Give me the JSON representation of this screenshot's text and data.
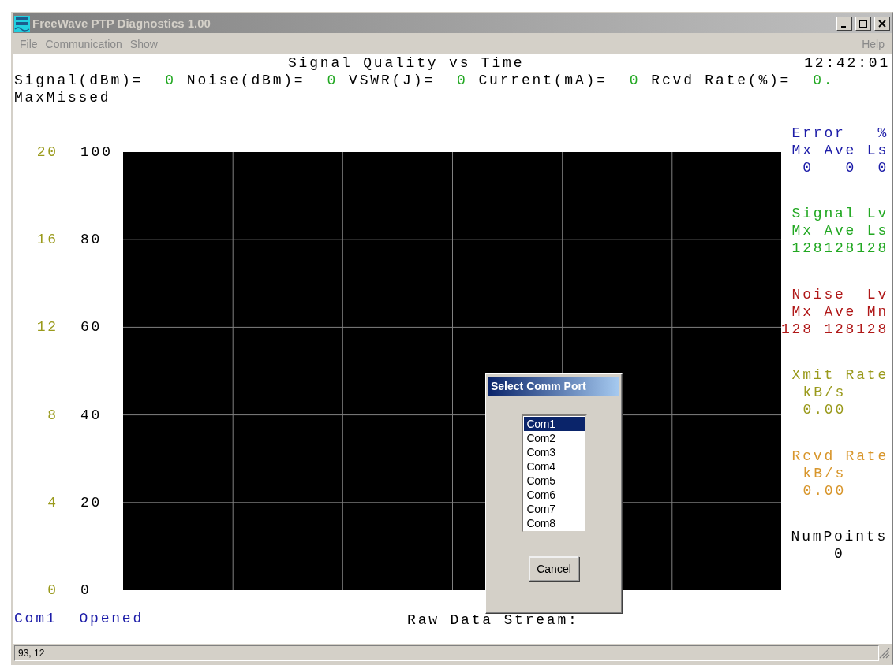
{
  "window": {
    "title": "FreeWave PTP Diagnostics 1.00",
    "active": false
  },
  "menu": [
    {
      "label": "File",
      "disabled": true
    },
    {
      "label": "Communication",
      "disabled": true
    },
    {
      "label": "Show",
      "disabled": true
    }
  ],
  "help_menu": {
    "label": "Help",
    "disabled": true
  },
  "header": {
    "title": "Signal Quality vs Time",
    "time": "12:42:01"
  },
  "readings": [
    {
      "label": "Signal(dBm)=",
      "value": "0"
    },
    {
      "label": "Noise(dBm)=",
      "value": "0"
    },
    {
      "label": "VSWR(J)=",
      "value": "0"
    },
    {
      "label": "Current(mA)=",
      "value": "0"
    },
    {
      "label": "Rcvd Rate(%)=",
      "value": "0."
    }
  ],
  "max_missed": "MaxMissed",
  "chart": {
    "left_axis": [
      "20",
      "16",
      "12",
      "8",
      "4",
      "0"
    ],
    "right_axis": [
      "100",
      "80",
      "60",
      "40",
      "20",
      "0"
    ]
  },
  "stats": [
    {
      "kind": "table",
      "color": "#1c1ca8",
      "lines": [
        "Error   %",
        "Mx Ave Ls",
        "0   0  0"
      ]
    },
    {
      "kind": "table",
      "color": "#22a822",
      "lines": [
        "Signal Lv",
        "Mx Ave Ls",
        "128128128"
      ]
    },
    {
      "kind": "table",
      "color": "#b01818",
      "lines": [
        "Noise  Lv",
        "Mx Ave Mn",
        "128 128128"
      ]
    },
    {
      "kind": "rate",
      "color": "#9a9a1c",
      "lines": [
        "Xmit Rate",
        "kB/s",
        "0.00"
      ]
    },
    {
      "kind": "rate",
      "color": "#d8962c",
      "lines": [
        "Rcvd Rate",
        "kB/s",
        "0.00"
      ]
    },
    {
      "kind": "count",
      "color": "#000000",
      "lines": [
        "NumPoints",
        "0"
      ]
    }
  ],
  "raw_data_label": "Raw Data Stream:",
  "port_status": {
    "port": "Com1",
    "state": "Opened"
  },
  "status_bar": {
    "text": "93, 12"
  },
  "dialog": {
    "title": "Select Comm Port",
    "ports": [
      {
        "label": "Com1",
        "selected": true
      },
      {
        "label": "Com2",
        "selected": false
      },
      {
        "label": "Com3",
        "selected": false
      },
      {
        "label": "Com4",
        "selected": false
      },
      {
        "label": "Com5",
        "selected": false
      },
      {
        "label": "Com6",
        "selected": false
      },
      {
        "label": "Com7",
        "selected": false
      },
      {
        "label": "Com8",
        "selected": false
      }
    ],
    "cancel": "Cancel"
  }
}
